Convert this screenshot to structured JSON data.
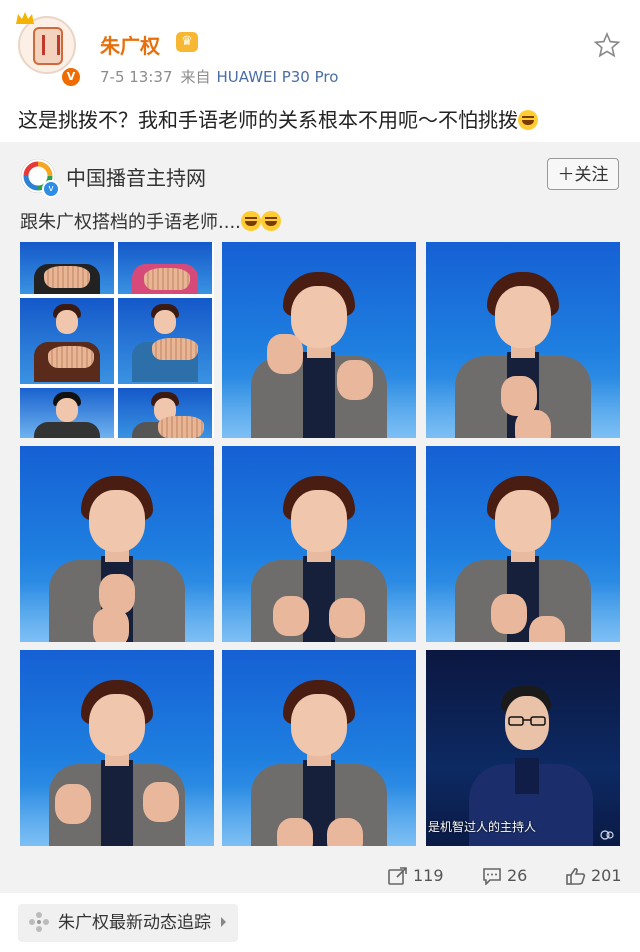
{
  "post": {
    "author": "朱广权",
    "time": "7-5 13:37",
    "source_prefix": "来自",
    "device": "HUAWEI P30 Pro",
    "text": "这是挑拨不？我和手语老师的关系根本不用呃～不怕挑拨",
    "icons": [
      "crown-icon",
      "verified-badge-icon",
      "vip-crown-icon",
      "star-icon"
    ]
  },
  "repost": {
    "account": "中国播音主持网",
    "follow_label": "＋关注",
    "text": "跟朱广权搭档的手语老师....",
    "images": [
      {
        "kind": "collage"
      },
      {
        "kind": "sign-language-teacher"
      },
      {
        "kind": "sign-language-teacher"
      },
      {
        "kind": "sign-language-teacher"
      },
      {
        "kind": "sign-language-teacher"
      },
      {
        "kind": "sign-language-teacher"
      },
      {
        "kind": "sign-language-teacher"
      },
      {
        "kind": "sign-language-teacher"
      },
      {
        "kind": "host",
        "caption": "是机智过人的主持人"
      }
    ]
  },
  "actions": {
    "repost_count": "119",
    "comment_count": "26",
    "like_count": "201"
  },
  "topic": {
    "label": "朱广权最新动态追踪"
  },
  "colors": {
    "username": "#e8700c",
    "device_link": "#4a6da7",
    "repost_bg": "#f2f2f2",
    "studio_blue": "#1f7fe0"
  }
}
